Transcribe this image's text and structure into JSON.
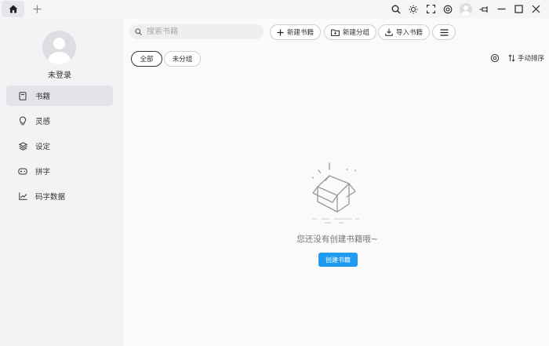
{
  "titlebar": {
    "home_icon": "home-icon",
    "new_tab_icon": "plus-icon",
    "controls": [
      "search-icon",
      "theme-sun-icon",
      "fullscreen-icon",
      "settings-icon",
      "avatar",
      "pin-icon",
      "minimize-icon",
      "maximize-icon",
      "close-icon"
    ]
  },
  "sidebar": {
    "user_label": "未登录",
    "items": [
      {
        "label": "书籍",
        "icon": "book-icon",
        "active": true
      },
      {
        "label": "灵感",
        "icon": "lightbulb-icon",
        "active": false
      },
      {
        "label": "设定",
        "icon": "layers-icon",
        "active": false
      },
      {
        "label": "拼字",
        "icon": "gamepad-icon",
        "active": false
      },
      {
        "label": "码字数据",
        "icon": "chart-line-icon",
        "active": false
      }
    ]
  },
  "toolbar": {
    "search_placeholder": "搜索书籍",
    "new_book_label": "新建书籍",
    "new_group_label": "新建分组",
    "import_label": "导入书籍"
  },
  "filters": {
    "all_label": "全部",
    "ungrouped_label": "未分组"
  },
  "sort": {
    "label": "手动排序"
  },
  "empty": {
    "message": "您还没有创建书籍哦~",
    "create_label": "创建书籍"
  },
  "colors": {
    "accent": "#1e9bf0",
    "sidebar_bg": "#f3f3f6",
    "main_bg": "#fafafa"
  }
}
